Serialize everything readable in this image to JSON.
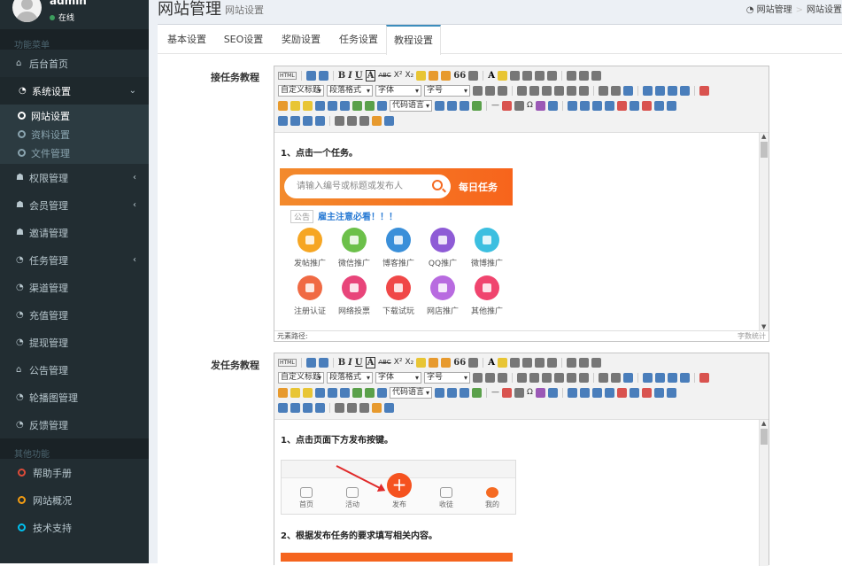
{
  "sidebar": {
    "user": {
      "name": "admin",
      "status": "在线"
    },
    "section_main": "功能菜单",
    "items": [
      {
        "label": "后台首页",
        "icon": "home-icon"
      },
      {
        "label": "系统设置",
        "icon": "dashboard-icon",
        "arrow": "⌄"
      },
      {
        "label": "权限管理",
        "icon": "users-icon",
        "arrow": "‹"
      },
      {
        "label": "会员管理",
        "icon": "users-icon",
        "arrow": "‹"
      },
      {
        "label": "邀请管理",
        "icon": "users-icon"
      },
      {
        "label": "任务管理",
        "icon": "dashboard-icon",
        "arrow": "‹"
      },
      {
        "label": "渠道管理",
        "icon": "dashboard-icon"
      },
      {
        "label": "充值管理",
        "icon": "dashboard-icon"
      },
      {
        "label": "提现管理",
        "icon": "dashboard-icon"
      },
      {
        "label": "公告管理",
        "icon": "home-icon"
      },
      {
        "label": "轮播图管理",
        "icon": "dashboard-icon"
      },
      {
        "label": "反馈管理",
        "icon": "dashboard-icon"
      }
    ],
    "submenu": [
      {
        "label": "网站设置"
      },
      {
        "label": "资料设置"
      },
      {
        "label": "文件管理"
      }
    ],
    "section_other": "其他功能",
    "other": [
      {
        "label": "帮助手册",
        "color": "#dd4b39"
      },
      {
        "label": "网站概况",
        "color": "#f39c12"
      },
      {
        "label": "技术支持",
        "color": "#00c0ef"
      }
    ]
  },
  "header": {
    "title": "网站管理",
    "subtitle": "网站设置",
    "breadcrumb": [
      "网站管理",
      "网站设置"
    ]
  },
  "tabs": [
    "基本设置",
    "SEO设置",
    "奖励设置",
    "任务设置",
    "教程设置"
  ],
  "fields": [
    {
      "label": "接任务教程"
    },
    {
      "label": "发任务教程"
    }
  ],
  "toolbar": {
    "html": "HTML",
    "bold": "B",
    "italic": "I",
    "underline": "U",
    "border": "A",
    "strike": "ABC",
    "sup": "X²",
    "sub": "X₂",
    "quote": "66",
    "font_color": "A",
    "selects": [
      "自定义标题",
      "段落格式",
      "字体",
      "字号"
    ],
    "codelang": "代码语言",
    "omega": "Ω"
  },
  "editor1": {
    "step1": "1、点击一个任务。",
    "search_placeholder": "请输入编号或标题或发布人",
    "daily": "每日任务",
    "notice_tag": "公告",
    "notice_text": "雇主注意必看！！！",
    "grid": [
      {
        "label": "发帖推广",
        "color": "#f6a623"
      },
      {
        "label": "微信推广",
        "color": "#6cc04a"
      },
      {
        "label": "博客推广",
        "color": "#3a8fd9"
      },
      {
        "label": "QQ推广",
        "color": "#8e5bd6"
      },
      {
        "label": "微博推广",
        "color": "#3cbfe0"
      },
      {
        "label": "注册认证",
        "color": "#f06a44"
      },
      {
        "label": "网络投票",
        "color": "#e8457a"
      },
      {
        "label": "下载试玩",
        "color": "#f04848"
      },
      {
        "label": "网店推广",
        "color": "#b86be0"
      },
      {
        "label": "其他推广",
        "color": "#f0456e"
      }
    ],
    "path_label": "元素路径:",
    "count_label": "字数统计"
  },
  "editor2": {
    "step1": "1、点击页面下方发布按键。",
    "nav": [
      "首页",
      "活动",
      "发布",
      "收徒",
      "我的"
    ],
    "plus": "+",
    "step2": "2、根据发布任务的要求填写相关内容。"
  }
}
